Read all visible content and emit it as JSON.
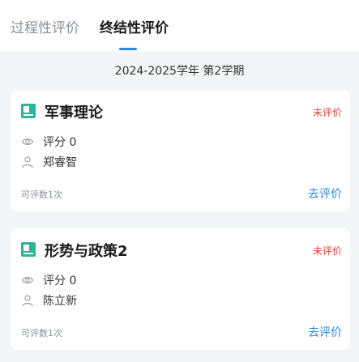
{
  "tabs": [
    {
      "label": "过程性评价"
    },
    {
      "label": "终结性评价"
    }
  ],
  "term": "2024-2025学年 第2学期",
  "courses": [
    {
      "name": "军事理论",
      "status": "未评价",
      "score_label": "评分 0",
      "teacher": "郑睿智",
      "remaining": "可评数1次",
      "action": "去评价"
    },
    {
      "name": "形势与政策2",
      "status": "未评价",
      "score_label": "评分 0",
      "teacher": "陈立新",
      "remaining": "可评数1次",
      "action": "去评价"
    }
  ],
  "icons": {
    "course": "book-icon",
    "score": "eye-icon",
    "teacher": "person-icon"
  },
  "colors": {
    "accent": "#2e86de",
    "course_icon": "#2bb59a",
    "status_pending": "#e0413c"
  }
}
